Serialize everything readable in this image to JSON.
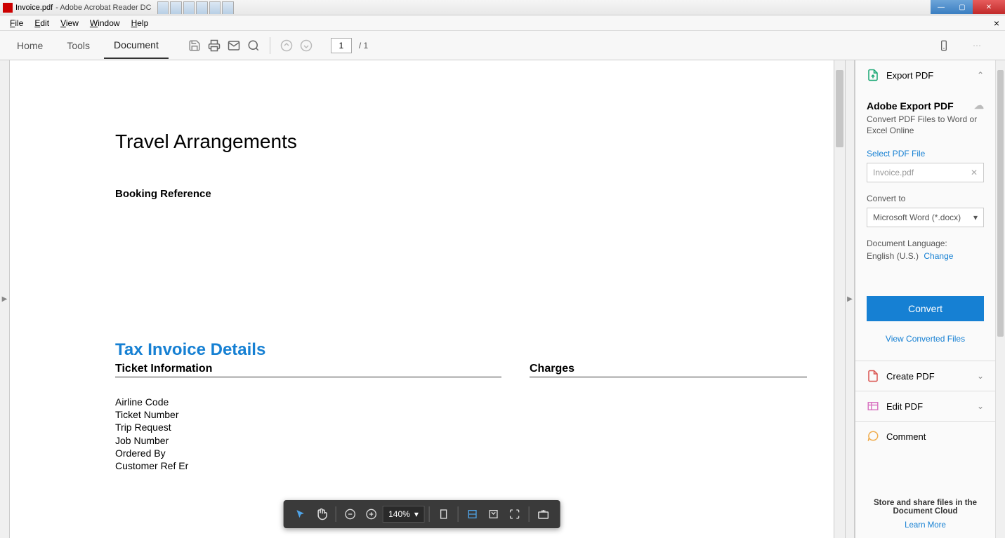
{
  "titlebar": {
    "filename": "Invoice.pdf",
    "app_suffix": " - Adobe Acrobat Reader DC",
    "browser_tabs": [
      "",
      "",
      "",
      "",
      "",
      ""
    ]
  },
  "menubar": {
    "items": [
      "File",
      "Edit",
      "View",
      "Window",
      "Help"
    ],
    "close_char": "×"
  },
  "toolbar": {
    "tabs": {
      "home": "Home",
      "tools": "Tools",
      "document": "Document"
    },
    "page_current": "1",
    "page_total": "/ 1"
  },
  "doc": {
    "title": "Travel Arrangements",
    "booking_ref": "Booking Reference",
    "tax_title": "Tax Invoice Details",
    "ticket_info_h": "Ticket Information",
    "charges_h": "Charges",
    "fields": [
      "Airline Code",
      "Ticket Number",
      "Trip Request",
      "Job Number",
      "Ordered By",
      "Customer Ref Er"
    ]
  },
  "rp": {
    "export_head": "Export PDF",
    "export_title": "Adobe Export PDF",
    "export_sub": "Convert PDF Files to Word or Excel Online",
    "select_file_label": "Select PDF File",
    "selected_file": "Invoice.pdf",
    "convert_to_label": "Convert to",
    "convert_to_value": "Microsoft Word (*.docx)",
    "lang_label": "Document Language:",
    "lang_value": "English (U.S.)",
    "lang_change": "Change",
    "convert_btn": "Convert",
    "view_converted": "View Converted Files",
    "create_pdf": "Create PDF",
    "edit_pdf": "Edit PDF",
    "comment": "Comment",
    "cloud_text": "Store and share files in the Document Cloud",
    "learn_more": "Learn More"
  },
  "floatbar": {
    "zoom": "140%"
  }
}
